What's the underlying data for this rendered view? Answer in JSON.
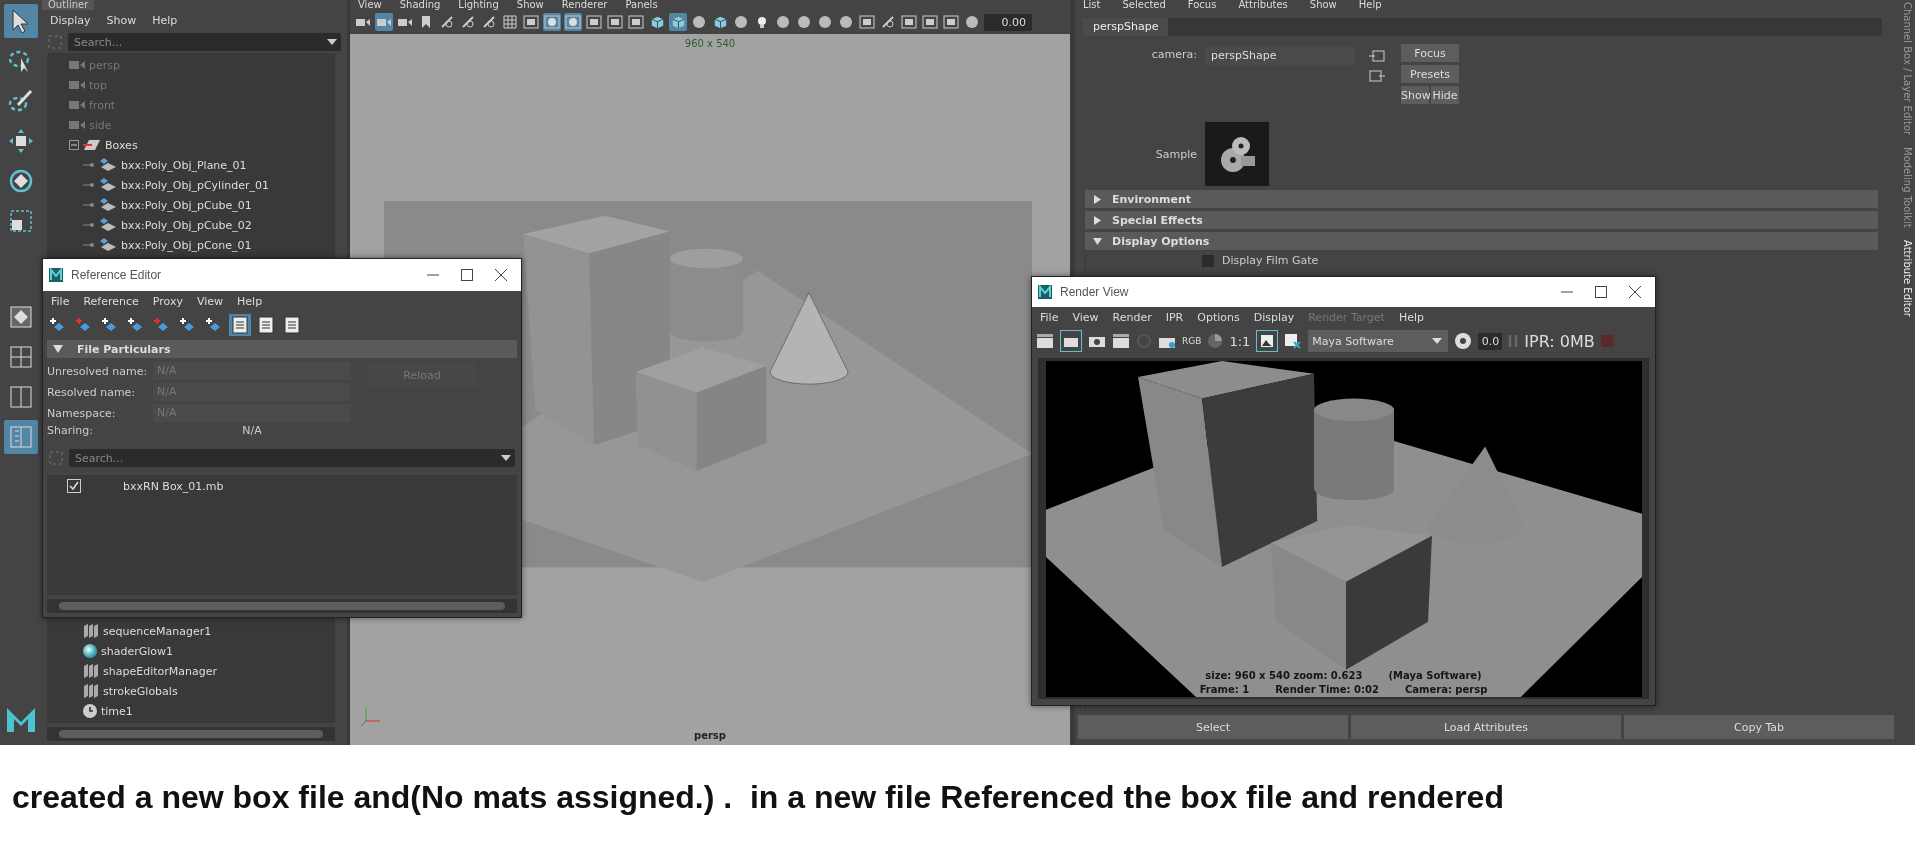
{
  "left_toolbar": {
    "tools": [
      {
        "kind": "select",
        "selected": true
      },
      {
        "kind": "lasso",
        "selected": false
      },
      {
        "kind": "paint",
        "selected": false
      },
      {
        "kind": "move",
        "selected": false
      },
      {
        "kind": "rotate",
        "selected": false
      },
      {
        "kind": "scale",
        "selected": false
      }
    ],
    "layouts": [
      {
        "kind": "single",
        "selected": false
      },
      {
        "kind": "quad",
        "selected": false
      },
      {
        "kind": "split",
        "selected": false
      },
      {
        "kind": "outliner",
        "selected": true
      }
    ]
  },
  "outliner": {
    "tab": "Outliner",
    "menu": [
      "Display",
      "Show",
      "Help"
    ],
    "search": {
      "placeholder": "Search..."
    },
    "items": [
      {
        "label": "persp",
        "kind": "camera",
        "dimmed": true
      },
      {
        "label": "top",
        "kind": "camera",
        "dimmed": true
      },
      {
        "label": "front",
        "kind": "camera",
        "dimmed": true
      },
      {
        "label": "side",
        "kind": "camera",
        "dimmed": true
      },
      {
        "label": "Boxes",
        "kind": "reference",
        "dimmed": false,
        "expanded": true,
        "children": [
          {
            "label": "bxx:Poly_Obj_Plane_01",
            "kind": "mesh",
            "dimmed": false
          },
          {
            "label": "bxx:Poly_Obj_pCylinder_01",
            "kind": "mesh",
            "dimmed": false
          },
          {
            "label": "bxx:Poly_Obj_pCube_01",
            "kind": "mesh",
            "dimmed": false
          },
          {
            "label": "bxx:Poly_Obj_pCube_02",
            "kind": "mesh",
            "dimmed": false
          },
          {
            "label": "bxx:Poly_Obj_pCone_01",
            "kind": "mesh",
            "dimmed": false
          }
        ]
      }
    ],
    "lower_items": [
      {
        "label": "sequenceManager1",
        "kind": "node"
      },
      {
        "label": "shaderGlow1",
        "kind": "shader"
      },
      {
        "label": "shapeEditorManager",
        "kind": "node"
      },
      {
        "label": "strokeGlobals",
        "kind": "node"
      },
      {
        "label": "time1",
        "kind": "time"
      }
    ]
  },
  "viewport": {
    "menu": [
      "View",
      "Shading",
      "Lighting",
      "Show",
      "Renderer",
      "Panels"
    ],
    "toolbar": [
      {
        "kind": "camera",
        "selected": false
      },
      {
        "kind": "camera",
        "selected": true
      },
      {
        "kind": "camera",
        "selected": false
      },
      {
        "kind": "bookmark",
        "selected": false
      },
      {
        "kind": "tool",
        "selected": false
      },
      {
        "kind": "tool",
        "selected": false
      },
      {
        "kind": "tool",
        "selected": false
      },
      {
        "kind": "grid",
        "selected": false
      },
      {
        "kind": "frame",
        "selected": false
      },
      {
        "kind": "circle",
        "selected": true
      },
      {
        "kind": "circle",
        "selected": true
      },
      {
        "kind": "frame",
        "selected": false
      },
      {
        "kind": "frame",
        "selected": false
      },
      {
        "kind": "frame",
        "selected": false
      },
      {
        "kind": "cube",
        "selected": false
      },
      {
        "kind": "cube",
        "selected": true
      },
      {
        "kind": "sphere",
        "selected": false
      },
      {
        "kind": "cube",
        "selected": false
      },
      {
        "kind": "sphere",
        "selected": false
      },
      {
        "kind": "light",
        "selected": false
      },
      {
        "kind": "sphere",
        "selected": false
      },
      {
        "kind": "sphere",
        "selected": false
      },
      {
        "kind": "sphere",
        "selected": false
      },
      {
        "kind": "sphere",
        "selected": false
      },
      {
        "kind": "frame",
        "selected": false
      },
      {
        "kind": "tool",
        "selected": false
      },
      {
        "kind": "frame",
        "selected": false
      },
      {
        "kind": "frame",
        "selected": false
      },
      {
        "kind": "frame",
        "selected": false
      },
      {
        "kind": "sphere",
        "selected": false
      }
    ],
    "exposure": "0.00",
    "resolution": "960 x 540",
    "camera": "persp"
  },
  "attribute_editor": {
    "menu": [
      "List",
      "Selected",
      "Focus",
      "Attributes",
      "Show",
      "Help"
    ],
    "tab": "perspShape",
    "camera_label": "camera:",
    "camera_value": "perspShape",
    "buttons": [
      "Focus",
      "Presets"
    ],
    "show_hide": [
      "Show",
      "Hide"
    ],
    "sample_label": "Sample",
    "sections": [
      {
        "label": "Environment",
        "expanded": false
      },
      {
        "label": "Special Effects",
        "expanded": false
      },
      {
        "label": "Display Options",
        "expanded": true
      }
    ],
    "checkbox": {
      "label": "Display Film Gate",
      "checked": false
    },
    "bottom_buttons": [
      "Select",
      "Load Attributes",
      "Copy Tab"
    ],
    "side_tabs": [
      {
        "label": "Channel Box / Layer Editor",
        "selected": false
      },
      {
        "label": "Modeling Toolkit",
        "selected": false
      },
      {
        "label": "Attribute Editor",
        "selected": true
      }
    ]
  },
  "reference_editor": {
    "title": "Reference Editor",
    "menu": [
      "File",
      "Reference",
      "Proxy",
      "View",
      "Help"
    ],
    "toolbar": [
      {
        "selected": false
      },
      {
        "selected": false
      },
      {
        "selected": false
      },
      {
        "selected": false
      },
      {
        "selected": false
      },
      {
        "selected": false
      },
      {
        "selected": false
      },
      {
        "selected": true
      },
      {
        "selected": false
      },
      {
        "selected": false
      }
    ],
    "section": {
      "label": "File Particulars",
      "expanded": true
    },
    "fields": [
      {
        "label": "Unresolved name:",
        "value": "N/A"
      },
      {
        "label": "Resolved name:",
        "value": "N/A"
      },
      {
        "label": "Namespace:",
        "value": "N/A"
      }
    ],
    "sharing": {
      "label": "Sharing:",
      "value": "N/A"
    },
    "reload": {
      "label": "Reload",
      "disabled": true
    },
    "search": {
      "placeholder": "Search..."
    },
    "references": [
      {
        "label": "bxxRN Box_01.mb",
        "checked": true
      }
    ]
  },
  "render_view": {
    "title": "Render View",
    "menu": [
      {
        "label": "File",
        "disabled": false
      },
      {
        "label": "View",
        "disabled": false
      },
      {
        "label": "Render",
        "disabled": false
      },
      {
        "label": "IPR",
        "disabled": false
      },
      {
        "label": "Options",
        "disabled": false
      },
      {
        "label": "Display",
        "disabled": false
      },
      {
        "label": "Render Target",
        "disabled": true
      },
      {
        "label": "Help",
        "disabled": false
      }
    ],
    "rgb": "RGB",
    "ratio": "1:1",
    "renderer": "Maya Software",
    "exposure": "0.0",
    "ipr": "IPR: 0MB",
    "info": [
      [
        "size: 960 x 540 zoom: 0.623",
        "(Maya Software)"
      ],
      [
        "Frame: 1",
        "Render Time: 0:02",
        "Camera: persp"
      ]
    ]
  },
  "caption": "created a new box file and(No mats assigned.) .  in a new file Referenced the box file and rendered"
}
